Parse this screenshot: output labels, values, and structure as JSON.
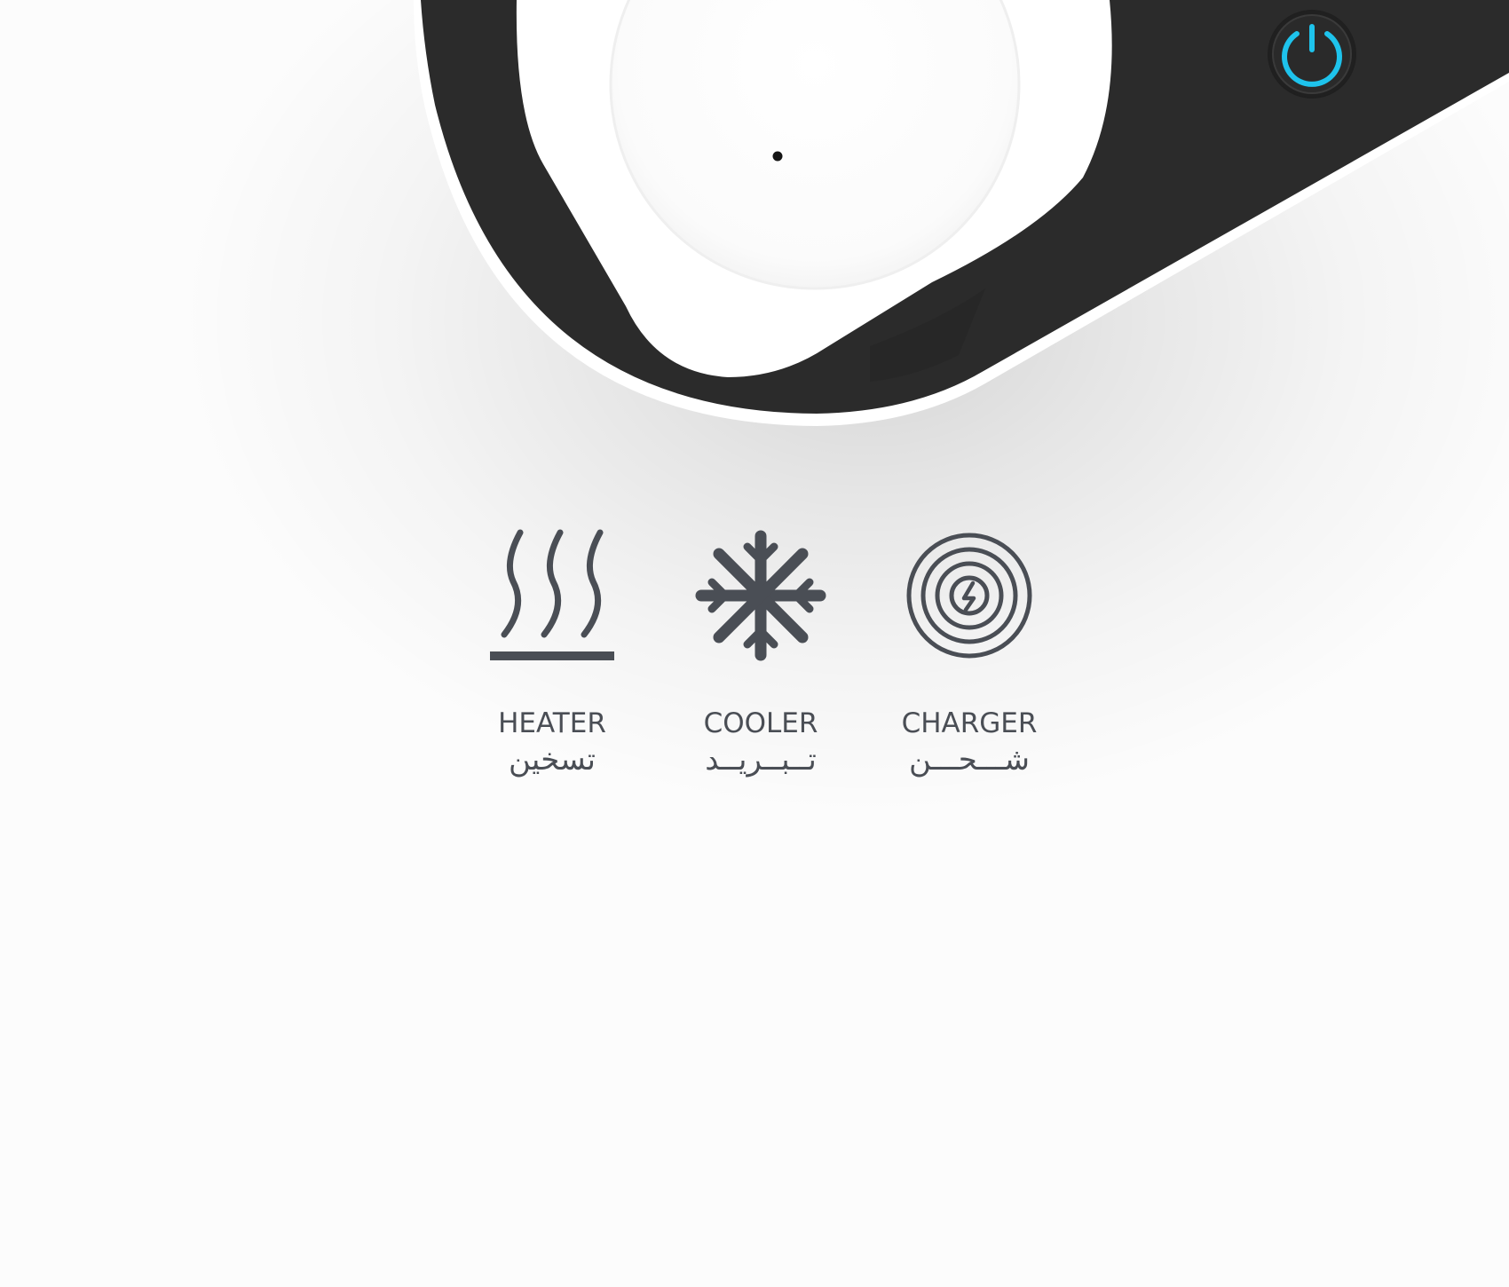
{
  "colors": {
    "device_body": "#2b2b2b",
    "device_rim": "#ffffff",
    "pad_surface": "#ffffff",
    "icon_color": "#4a4e55",
    "power_accent": "#1ec3ec"
  },
  "device": {
    "power_button_icon": "power-icon",
    "status_led": "dot"
  },
  "features": [
    {
      "icon": "heat-waves-icon",
      "label_en": "HEATER",
      "label_ar": "تسخين"
    },
    {
      "icon": "snowflake-icon",
      "label_en": "COOLER",
      "label_ar": "تــبــريــد"
    },
    {
      "icon": "wireless-charging-icon",
      "label_en": "CHARGER",
      "label_ar": "شـــحـــن"
    }
  ]
}
